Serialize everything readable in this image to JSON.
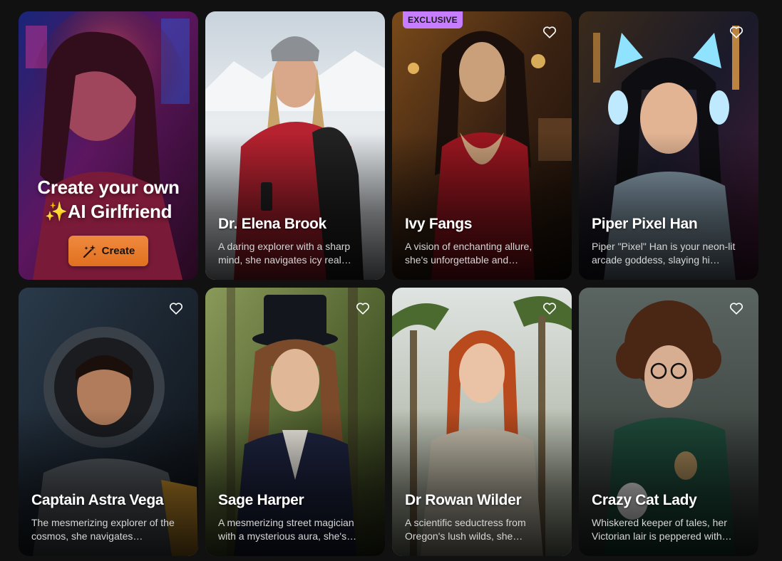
{
  "create_card": {
    "title_line1": "Create your own",
    "title_line2": "AI Girlfriend",
    "sparkle_emoji": "✨",
    "button_label": "Create",
    "button_color": "#e97a2c"
  },
  "cards": [
    {
      "name": "Dr. Elena Brook",
      "description": "A daring explorer with a sharp mind, she navigates icy real…",
      "exclusive": false,
      "favorite_icon": false
    },
    {
      "name": "Ivy Fangs",
      "description": "A vision of enchanting allure, she's unforgettable and…",
      "exclusive": true,
      "badge": "EXCLUSIVE",
      "favorite_icon": true
    },
    {
      "name": "Piper Pixel Han",
      "description": "Piper \"Pixel\" Han is your neon-lit arcade goddess, slaying hi…",
      "exclusive": false,
      "favorite_icon": true
    },
    {
      "name": "Captain Astra Vega",
      "description": "The mesmerizing explorer of the cosmos, she navigates…",
      "exclusive": false,
      "favorite_icon": true
    },
    {
      "name": "Sage Harper",
      "description": "A mesmerizing street magician with a mysterious aura, she's…",
      "exclusive": false,
      "favorite_icon": true
    },
    {
      "name": "Dr Rowan Wilder",
      "description": "A scientific seductress from Oregon's lush wilds, she…",
      "exclusive": false,
      "favorite_icon": true
    },
    {
      "name": "Crazy Cat Lady",
      "description": "Whiskered keeper of tales, her Victorian lair is peppered with…",
      "exclusive": false,
      "favorite_icon": true
    }
  ],
  "colors": {
    "background": "#111111",
    "badge": "#c77dff",
    "accent_orange": "#e97a2c"
  }
}
